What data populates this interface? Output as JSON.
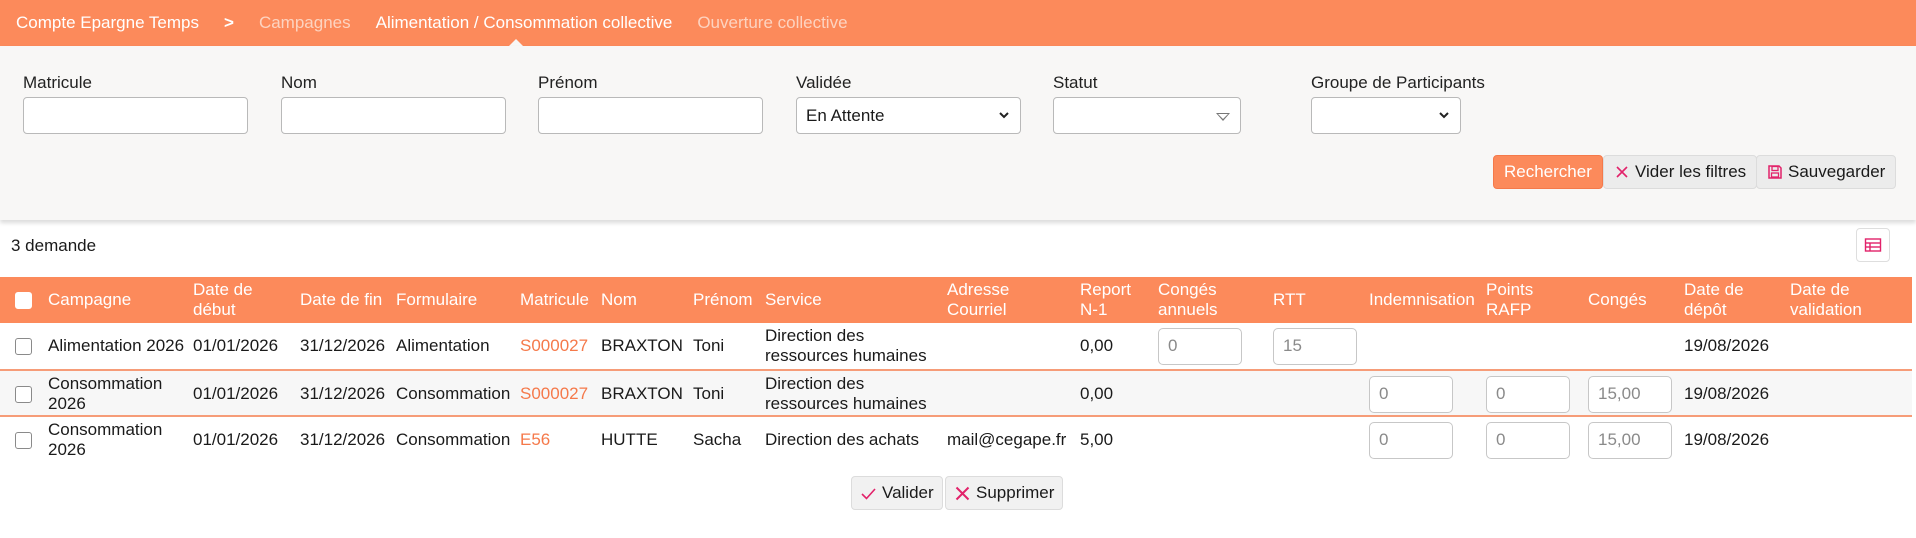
{
  "nav": {
    "items": [
      {
        "label": "Compte Epargne Temps",
        "state": "normal"
      },
      {
        "label": ">",
        "state": "separator"
      },
      {
        "label": "Campagnes",
        "state": "dim"
      },
      {
        "label": "Alimentation / Consommation collective",
        "state": "active"
      },
      {
        "label": "Ouverture collective",
        "state": "dim"
      }
    ]
  },
  "filters": {
    "matricule": {
      "label": "Matricule",
      "value": ""
    },
    "nom": {
      "label": "Nom",
      "value": ""
    },
    "prenom": {
      "label": "Prénom",
      "value": ""
    },
    "validee": {
      "label": "Validée",
      "value": "En Attente"
    },
    "statut": {
      "label": "Statut",
      "value": ""
    },
    "groupe": {
      "label": "Groupe de Participants",
      "value": ""
    },
    "buttons": {
      "search": "Rechercher",
      "clear": "Vider les filtres",
      "save": "Sauvegarder"
    }
  },
  "results": {
    "count_label": "3 demande"
  },
  "table": {
    "headers": {
      "campagne": "Campagne",
      "date_debut": "Date de début",
      "date_fin": "Date de fin",
      "formulaire": "Formulaire",
      "matricule": "Matricule",
      "nom": "Nom",
      "prenom": "Prénom",
      "service": "Service",
      "courriel": "Adresse Courriel",
      "report": "Report N-1",
      "conges_annuels": "Congés annuels",
      "rtt": "RTT",
      "indemnisation": "Indemnisation",
      "points_rafp": "Points RAFP",
      "conges": "Congés",
      "date_depot": "Date de dépôt",
      "date_validation": "Date de validation"
    },
    "rows": [
      {
        "campagne": "Alimentation 2026",
        "date_debut": "01/01/2026",
        "date_fin": "31/12/2026",
        "formulaire": "Alimentation",
        "matricule": "S000027",
        "nom": "BRAXTON",
        "prenom": "Toni",
        "service": "Direction des ressources humaines",
        "courriel": "",
        "report": "0,00",
        "conges_annuels": "0",
        "rtt": "15",
        "indemnisation": null,
        "points_rafp": null,
        "conges": null,
        "date_depot": "19/08/2026",
        "date_validation": ""
      },
      {
        "campagne": "Consommation 2026",
        "date_debut": "01/01/2026",
        "date_fin": "31/12/2026",
        "formulaire": "Consommation",
        "matricule": "S000027",
        "nom": "BRAXTON",
        "prenom": "Toni",
        "service": "Direction des ressources humaines",
        "courriel": "",
        "report": "0,00",
        "conges_annuels": null,
        "rtt": null,
        "indemnisation": "0",
        "points_rafp": "0",
        "conges": "15,00",
        "date_depot": "19/08/2026",
        "date_validation": ""
      },
      {
        "campagne": "Consommation 2026",
        "date_debut": "01/01/2026",
        "date_fin": "31/12/2026",
        "formulaire": "Consommation",
        "matricule": "E56",
        "nom": "HUTTE",
        "prenom": "Sacha",
        "service": "Direction des achats",
        "courriel": "mail@cegape.fr",
        "report": "5,00",
        "conges_annuels": null,
        "rtt": null,
        "indemnisation": "0",
        "points_rafp": "0",
        "conges": "15,00",
        "date_depot": "19/08/2026",
        "date_validation": ""
      }
    ]
  },
  "actions": {
    "validate": "Valider",
    "delete": "Supprimer"
  },
  "colors": {
    "accent": "#fc8a5b",
    "accent_dark": "#f5794a",
    "panel": "#f8f7f6",
    "save_icon": "#e2226a"
  },
  "icons": {
    "clear": "close-icon",
    "save": "floppy-disk-icon",
    "view": "table-view-icon",
    "validate": "checkmark-icon",
    "delete": "close-icon"
  }
}
